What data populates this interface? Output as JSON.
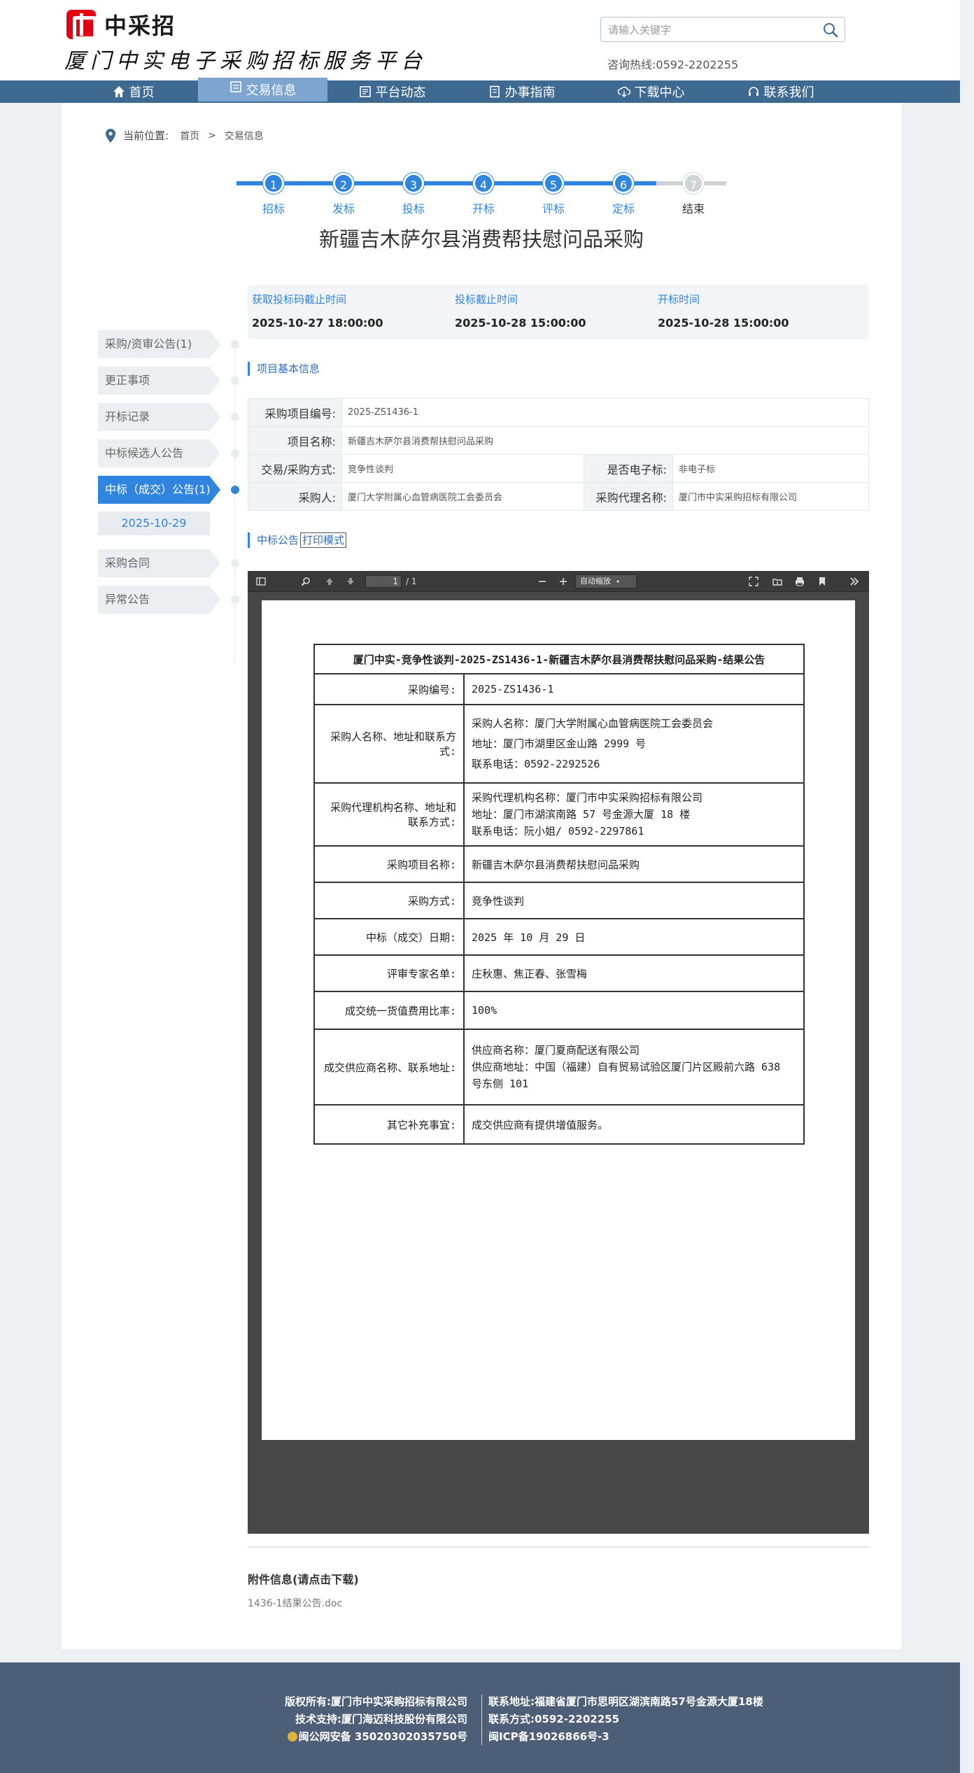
{
  "header": {
    "logo_text": "中采招",
    "platform_title": "厦门中实电子采购招标服务平台",
    "search_placeholder": "请输入关键字",
    "hotline": "咨询热线:0592-2202255"
  },
  "nav": [
    {
      "label": "首页",
      "icon": "home-icon",
      "active": false
    },
    {
      "label": "交易信息",
      "icon": "info-icon",
      "active": true
    },
    {
      "label": "平台动态",
      "icon": "news-icon",
      "active": false
    },
    {
      "label": "办事指南",
      "icon": "guide-icon",
      "active": false
    },
    {
      "label": "下载中心",
      "icon": "download-icon",
      "active": false
    },
    {
      "label": "联系我们",
      "icon": "headset-icon",
      "active": false
    }
  ],
  "breadcrumb": {
    "label": "当前位置:",
    "home": "首页",
    "sep": ">",
    "current": "交易信息"
  },
  "steps": [
    {
      "num": "1",
      "label": "招标",
      "done": true
    },
    {
      "num": "2",
      "label": "发标",
      "done": true
    },
    {
      "num": "3",
      "label": "投标",
      "done": true
    },
    {
      "num": "4",
      "label": "开标",
      "done": true
    },
    {
      "num": "5",
      "label": "评标",
      "done": true
    },
    {
      "num": "6",
      "label": "定标",
      "done": true
    },
    {
      "num": "7",
      "label": "结束",
      "done": false
    }
  ],
  "page_title": "新疆吉木萨尔县消费帮扶慰问品采购",
  "times": [
    {
      "label": "获取投标码截止时间",
      "value": "2025-10-27 18:00:00"
    },
    {
      "label": "投标截止时间",
      "value": "2025-10-28 15:00:00"
    },
    {
      "label": "开标时间",
      "value": "2025-10-28 15:00:00"
    }
  ],
  "side_menu": [
    {
      "label": "采购/资审公告(1)",
      "active": false
    },
    {
      "label": "更正事项",
      "active": false
    },
    {
      "label": "开标记录",
      "active": false
    },
    {
      "label": "中标候选人公告",
      "active": false
    },
    {
      "label": "中标（成交）公告(1)",
      "active": true
    },
    {
      "label": "采购合同",
      "active": false
    },
    {
      "label": "异常公告",
      "active": false
    }
  ],
  "side_sub_date": "2025-10-29",
  "basic_info": {
    "section_title": "项目基本信息",
    "project_no_label": "采购项目编号:",
    "project_no": "2025-ZS1436-1",
    "project_name_label": "项目名称:",
    "project_name": "新疆吉木萨尔县消费帮扶慰问品采购",
    "method_label": "交易/采购方式:",
    "method": "竞争性谈判",
    "electronic_label": "是否电子标:",
    "electronic": "非电子标",
    "buyer_label": "采购人:",
    "buyer": "厦门大学附属心血管病医院工会委员会",
    "agent_label": "采购代理名称:",
    "agent": "厦门市中实采购招标有限公司"
  },
  "notice": {
    "section_title": "中标公告",
    "print_label": "打印模式"
  },
  "pdf_viewer": {
    "page_current": "1",
    "page_total": "/ 1",
    "zoom": "自动缩放"
  },
  "result": {
    "title": "厦门中实-竞争性谈判-2025-ZS1436-1-新疆吉木萨尔县消费帮扶慰问品采购-结果公告",
    "rows": [
      {
        "k": "采购编号:",
        "v": [
          "2025-ZS1436-1"
        ]
      },
      {
        "k": "采购人名称、地址和联系方式:",
        "v": [
          "采购人名称：厦门大学附属心血管病医院工会委员会",
          "地址：厦门市湖里区金山路 2999 号",
          "联系电话：0592-2292526"
        ]
      },
      {
        "k": "采购代理机构名称、地址和联系方式:",
        "v": [
          "采购代理机构名称：厦门市中实采购招标有限公司",
          "地址：厦门市湖滨南路 57 号金源大厦 18 楼",
          "联系电话：阮小姐/ 0592-2297861"
        ]
      },
      {
        "k": "采购项目名称:",
        "v": [
          "新疆吉木萨尔县消费帮扶慰问品采购"
        ]
      },
      {
        "k": "采购方式:",
        "v": [
          "竞争性谈判"
        ]
      },
      {
        "k": "中标（成交）日期:",
        "v": [
          "2025 年 10 月 29 日"
        ]
      },
      {
        "k": "评审专家名单:",
        "v": [
          "庄秋惠、焦正春、张雪梅"
        ]
      },
      {
        "k": "成交统一货值费用比率:",
        "v": [
          "100%"
        ]
      },
      {
        "k": "成交供应商名称、联系地址:",
        "v": [
          "供应商名称：厦门夏商配送有限公司",
          "供应商地址：中国（福建）自有贸易试验区厦门片区殿前六路 638 号东侧 101"
        ]
      },
      {
        "k": "其它补充事宜:",
        "v": [
          "成交供应商有提供增值服务。"
        ]
      }
    ]
  },
  "attachment": {
    "title": "附件信息(请点击下载)",
    "file": "1436-1结果公告.doc"
  },
  "footer": {
    "left": [
      "版权所有:厦门市中实采购招标有限公司",
      "技术支持:厦门海迈科技股份有限公司",
      "闽公网安备 35020302035750号"
    ],
    "right": [
      "联系地址:福建省厦门市思明区湖滨南路57号金源大厦18楼",
      "联系方式:0592-2202255",
      "闽ICP备19026866号-3"
    ]
  },
  "colors": {
    "accent": "#2f85e0",
    "nav_bg": "#3e6a92",
    "nav_active": "#7ea5cf",
    "footer_bg": "#4c5f76",
    "logo_red": "#e60012"
  }
}
